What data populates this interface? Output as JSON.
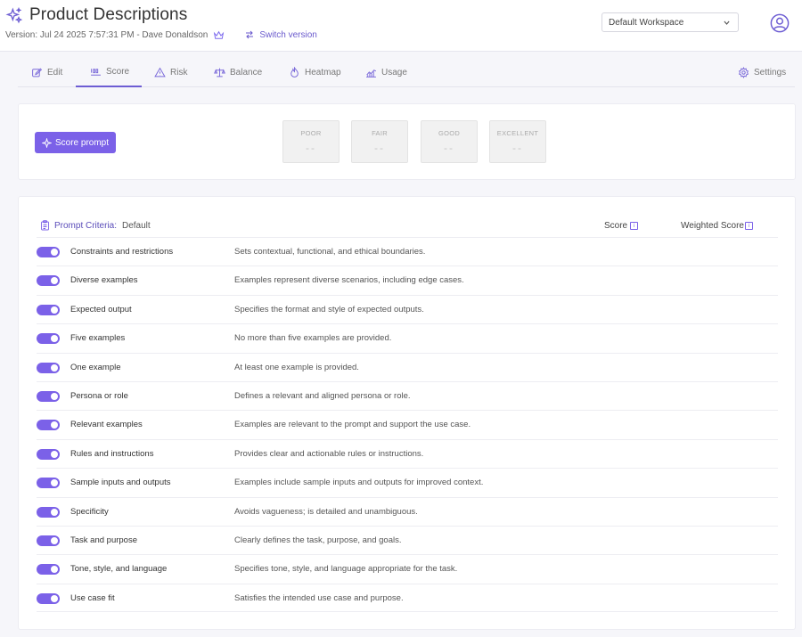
{
  "header": {
    "title": "Product Descriptions",
    "version_text": "Version: Jul 24 2025 7:57:31 PM - Dave Donaldson",
    "switch_version_label": "Switch version",
    "workspace": "Default Workspace"
  },
  "tabs": [
    {
      "label": "Edit",
      "icon": "edit-icon"
    },
    {
      "label": "Score",
      "icon": "score-icon"
    },
    {
      "label": "Risk",
      "icon": "warning-icon"
    },
    {
      "label": "Balance",
      "icon": "scale-icon"
    },
    {
      "label": "Heatmap",
      "icon": "heatmap-icon"
    },
    {
      "label": "Usage",
      "icon": "usage-chart-icon"
    },
    {
      "label": "Settings",
      "icon": "gear-icon"
    }
  ],
  "active_tab": "Score",
  "score_panel": {
    "button_label": "Score prompt",
    "ratings": [
      {
        "label": "POOR",
        "value": "--"
      },
      {
        "label": "FAIR",
        "value": "--"
      },
      {
        "label": "GOOD",
        "value": "--"
      },
      {
        "label": "EXCELLENT",
        "value": "--"
      }
    ]
  },
  "criteria": {
    "title": "Prompt Criteria:",
    "set_name": "Default",
    "score_header": "Score",
    "weighted_score_header": "Weighted Score",
    "rows": [
      {
        "name": "Constraints and restrictions",
        "description": "Sets contextual, functional, and ethical boundaries.",
        "enabled": true
      },
      {
        "name": "Diverse examples",
        "description": "Examples represent diverse scenarios, including edge cases.",
        "enabled": true
      },
      {
        "name": "Expected output",
        "description": "Specifies the format and style of expected outputs.",
        "enabled": true
      },
      {
        "name": "Five examples",
        "description": "No more than five examples are provided.",
        "enabled": true
      },
      {
        "name": "One example",
        "description": "At least one example is provided.",
        "enabled": true
      },
      {
        "name": "Persona or role",
        "description": "Defines a relevant and aligned persona or role.",
        "enabled": true
      },
      {
        "name": "Relevant examples",
        "description": "Examples are relevant to the prompt and support the use case.",
        "enabled": true
      },
      {
        "name": "Rules and instructions",
        "description": "Provides clear and actionable rules or instructions.",
        "enabled": true
      },
      {
        "name": "Sample inputs and outputs",
        "description": "Examples include sample inputs and outputs for improved context.",
        "enabled": true
      },
      {
        "name": "Specificity",
        "description": "Avoids vagueness; is detailed and unambiguous.",
        "enabled": true
      },
      {
        "name": "Task and purpose",
        "description": "Clearly defines the task, purpose, and goals.",
        "enabled": true
      },
      {
        "name": "Tone, style, and language",
        "description": "Specifies tone, style, and language appropriate for the task.",
        "enabled": true
      },
      {
        "name": "Use case fit",
        "description": "Satisfies the intended use case and purpose.",
        "enabled": true
      }
    ]
  },
  "colors": {
    "accent": "#7b61e8",
    "accent_text": "#5a4cb9",
    "background": "#f6f6fa"
  }
}
